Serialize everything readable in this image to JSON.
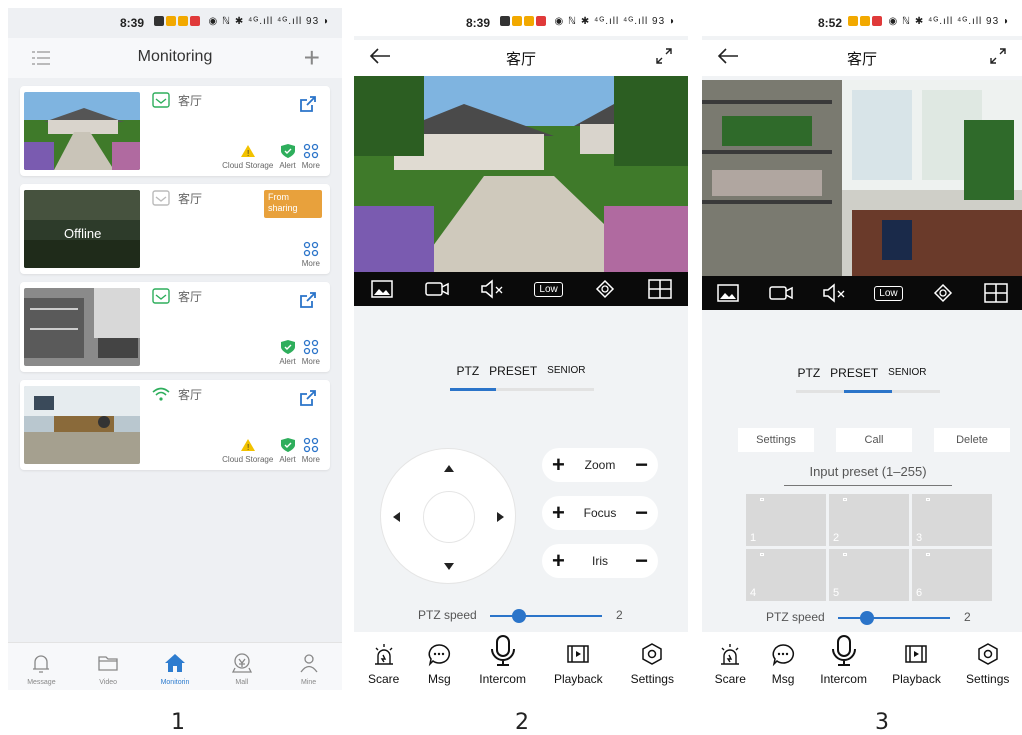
{
  "captions": [
    "1",
    "2",
    "3"
  ],
  "panel1": {
    "status": {
      "time": "8:39",
      "right": "◉ ℕ ✱ ⁴ᴳ.ıll ⁴ᴳ.ıll 93 ◗"
    },
    "header_title": "Monitoring",
    "cards": [
      {
        "name": "客厅",
        "actions": [
          "Cloud Storage",
          "Alert",
          "More"
        ]
      },
      {
        "name": "客厅",
        "offline": "Offline",
        "sharing": "From sharing",
        "actions": [
          "More"
        ]
      },
      {
        "name": "客厅",
        "actions": [
          "Alert",
          "More"
        ]
      },
      {
        "name": "客厅",
        "actions": [
          "Cloud Storage",
          "Alert",
          "More"
        ]
      }
    ],
    "tabs": [
      {
        "label": "Message",
        "icon": "bell-icon"
      },
      {
        "label": "Video",
        "icon": "folder-icon"
      },
      {
        "label": "Monitorin",
        "icon": "home-icon"
      },
      {
        "label": "Mall",
        "icon": "mall-icon"
      },
      {
        "label": "Mine",
        "icon": "user-icon"
      }
    ]
  },
  "panel2": {
    "status": {
      "time": "8:39",
      "right": "◉ ℕ ✱ ⁴ᴳ.ıll ⁴ᴳ.ıll 93 ◗"
    },
    "title": "客厅",
    "quality": "Low",
    "segments": [
      "PTZ",
      "PRESET",
      "SENIOR"
    ],
    "active_segment": "PTZ",
    "pills": [
      "Zoom",
      "Focus",
      "Iris"
    ],
    "speed_label": "PTZ speed",
    "speed_value": "2",
    "bottom": [
      "Scare",
      "Msg",
      "Intercom",
      "Playback",
      "Settings"
    ]
  },
  "panel3": {
    "status": {
      "time": "8:52",
      "right": "◉ ℕ ✱ ⁴ᴳ.ıll ⁴ᴳ.ıll 93 ◗"
    },
    "title": "客厅",
    "quality": "Low",
    "segments": [
      "PTZ",
      "PRESET",
      "SENIOR"
    ],
    "active_segment": "PRESET",
    "preset_buttons": [
      "Settings",
      "Call",
      "Delete"
    ],
    "preset_placeholder": "Input preset (1–255)",
    "presets": [
      "1",
      "2",
      "3",
      "4",
      "5",
      "6"
    ],
    "speed_label": "PTZ speed",
    "speed_value": "2",
    "bottom": [
      "Scare",
      "Msg",
      "Intercom",
      "Playback",
      "Settings"
    ]
  },
  "colors": {
    "accent": "#2b74c9",
    "green": "#2eae5c",
    "sharing": "#e8a13c"
  }
}
